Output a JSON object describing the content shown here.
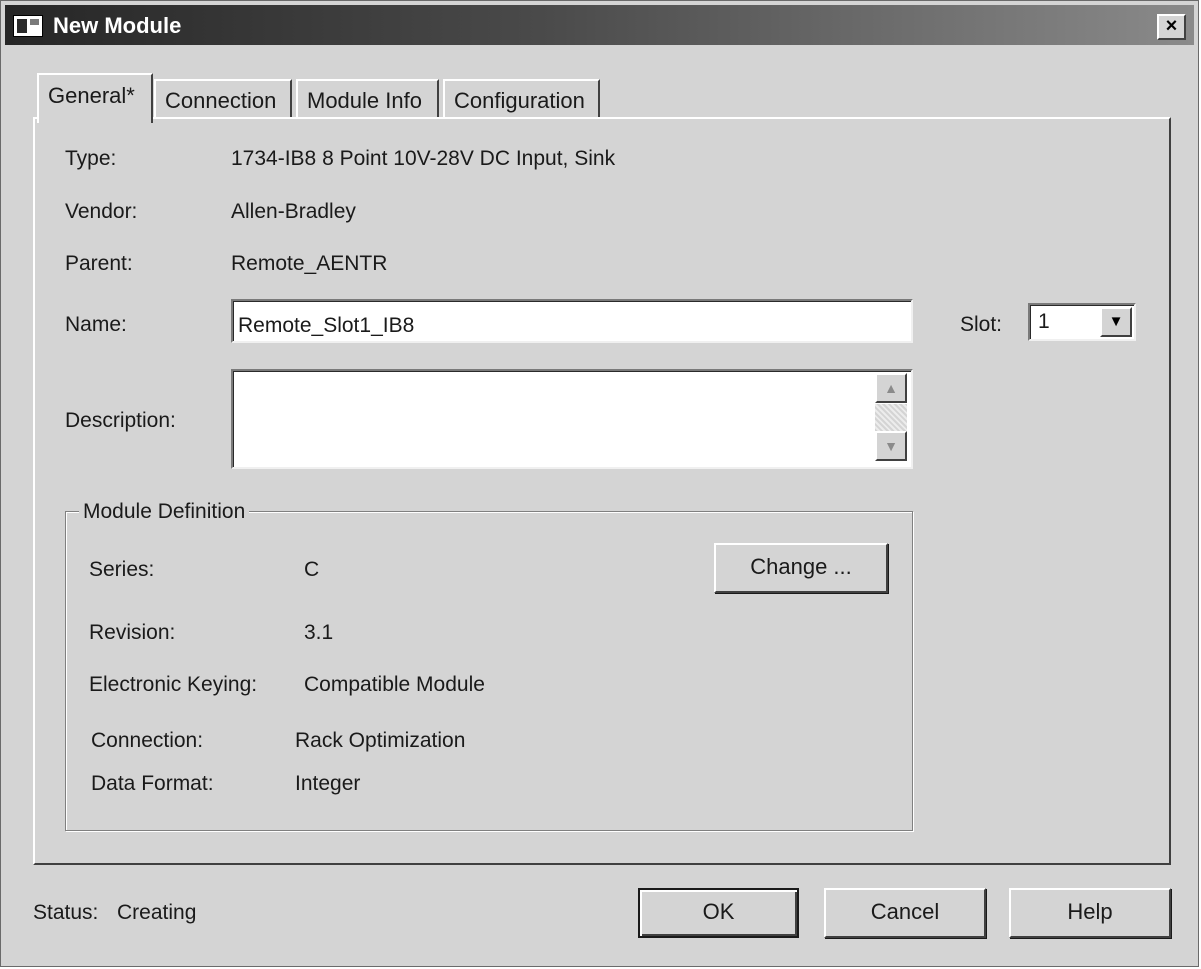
{
  "window": {
    "title": "New Module",
    "close_glyph": "×",
    "icon": "window-app-icon"
  },
  "tabs": [
    {
      "label": "General*",
      "active": true
    },
    {
      "label": "Connection",
      "active": false
    },
    {
      "label": "Module Info",
      "active": false
    },
    {
      "label": "Configuration",
      "active": false
    }
  ],
  "general": {
    "type_label": "Type:",
    "type_value": "1734-IB8 8 Point 10V-28V DC Input, Sink",
    "vendor_label": "Vendor:",
    "vendor_value": "Allen-Bradley",
    "parent_label": "Parent:",
    "parent_value": "Remote_AENTR",
    "name_label": "Name:",
    "name_value": "Remote_Slot1_IB8",
    "slot_label": "Slot:",
    "slot_value": "1",
    "description_label": "Description:",
    "description_value": ""
  },
  "module_definition": {
    "legend": "Module Definition",
    "series_label": "Series:",
    "series_value": "C",
    "revision_label": "Revision:",
    "revision_value": "3.1",
    "keying_label": "Electronic Keying:",
    "keying_value": "Compatible Module",
    "connection_label": "Connection:",
    "connection_value": "Rack Optimization",
    "data_format_label": "Data Format:",
    "data_format_value": "Integer",
    "change_button": "Change ..."
  },
  "footer": {
    "status_label": "Status:",
    "status_value": "Creating",
    "ok_button": "OK",
    "cancel_button": "Cancel",
    "help_button": "Help"
  },
  "icons": {
    "scroll_up": "▲",
    "scroll_down": "▼",
    "dropdown": "▼"
  },
  "colors": {
    "dialog_bg": "#d4d4d4",
    "titlebar_dark": "#262626",
    "titlebar_light": "#8a8a8a"
  }
}
